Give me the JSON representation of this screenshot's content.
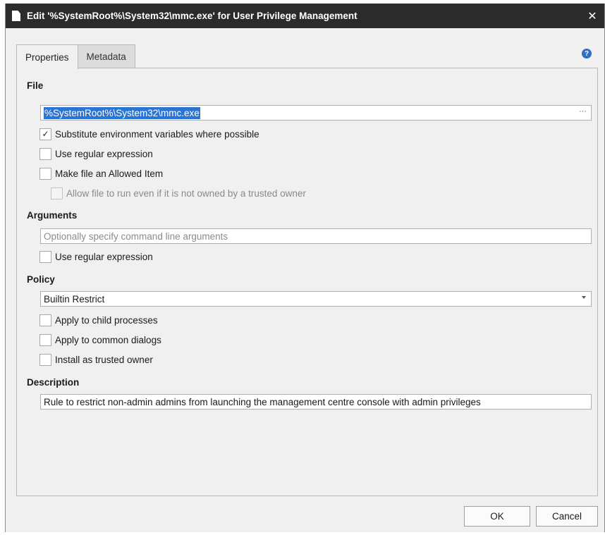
{
  "window": {
    "title": "Edit '%SystemRoot%\\System32\\mmc.exe' for User Privilege Management",
    "close_glyph": "✕",
    "icon": "document-icon"
  },
  "tabs": [
    {
      "label": "Properties",
      "active": true
    },
    {
      "label": "Metadata",
      "active": false
    }
  ],
  "help": {
    "glyph": "?",
    "icon": "help-icon"
  },
  "file": {
    "label": "File",
    "value": "%SystemRoot%\\System32\\mmc.exe",
    "browse_glyph": "···",
    "options": [
      {
        "label": "Substitute environment variables where possible",
        "checked": true,
        "enabled": true
      },
      {
        "label": "Use regular expression",
        "checked": false,
        "enabled": true
      },
      {
        "label": "Make file an Allowed Item",
        "checked": false,
        "enabled": true
      },
      {
        "label": "Allow file to run even if it is not owned by a trusted owner",
        "checked": false,
        "enabled": false
      }
    ]
  },
  "arguments": {
    "label": "Arguments",
    "placeholder": "Optionally specify command line arguments",
    "options": [
      {
        "label": "Use regular expression",
        "checked": false,
        "enabled": true
      }
    ]
  },
  "policy": {
    "label": "Policy",
    "selected": "Builtin Restrict",
    "options": [
      {
        "label": "Apply to child processes",
        "checked": false,
        "enabled": true
      },
      {
        "label": "Apply to common dialogs",
        "checked": false,
        "enabled": true
      },
      {
        "label": "Install as trusted owner",
        "checked": false,
        "enabled": true
      }
    ]
  },
  "description": {
    "label": "Description",
    "value": "Rule to restrict non-admin admins from launching the management centre console with admin privileges"
  },
  "buttons": {
    "ok": "OK",
    "cancel": "Cancel"
  },
  "colors": {
    "titlebar": "#2b2b2b",
    "selection": "#2a74d4",
    "help": "#2f6fc4",
    "dialog_bg": "#f0f0f0"
  }
}
